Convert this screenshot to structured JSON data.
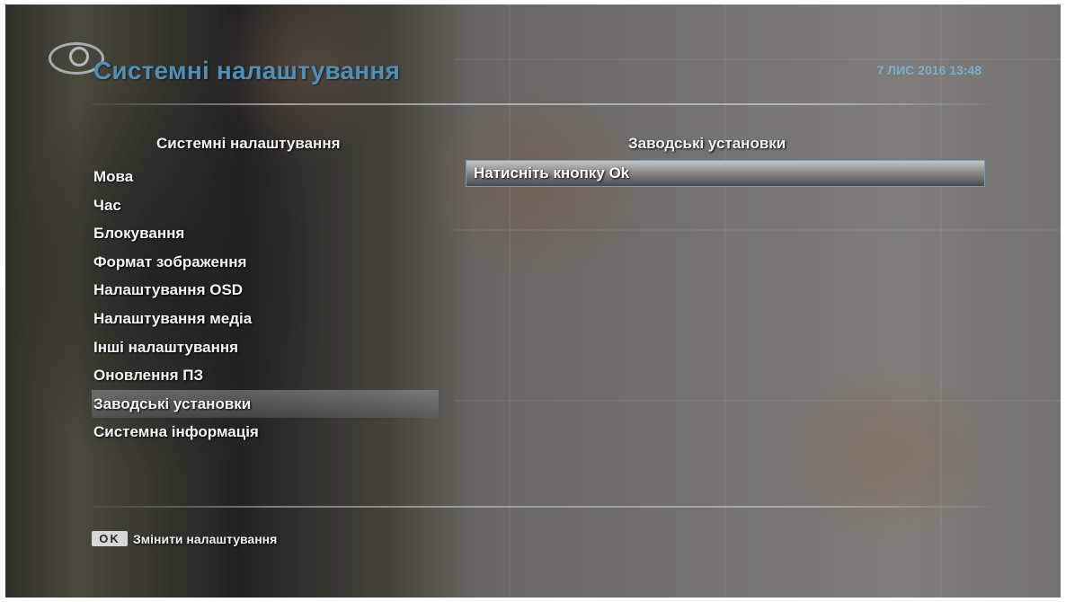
{
  "header": {
    "title": "Системні налаштування",
    "datetime": "7 ЛИС 2016 13:48"
  },
  "left_panel": {
    "heading": "Системні налаштування",
    "items": [
      {
        "label": "Мова",
        "selected": false
      },
      {
        "label": "Час",
        "selected": false
      },
      {
        "label": "Блокування",
        "selected": false
      },
      {
        "label": "Формат зображення",
        "selected": false
      },
      {
        "label": "Налаштування OSD",
        "selected": false
      },
      {
        "label": "Налаштування медіа",
        "selected": false
      },
      {
        "label": "Інші налаштування",
        "selected": false
      },
      {
        "label": "Оновлення ПЗ",
        "selected": false
      },
      {
        "label": "Заводські установки",
        "selected": true
      },
      {
        "label": "Системна інформація",
        "selected": false
      }
    ]
  },
  "right_panel": {
    "heading": "Заводські установки",
    "option": "Натисніть кнопку Ok"
  },
  "footer": {
    "key": "OK",
    "hint": "Змінити налаштування"
  },
  "colors": {
    "title": "#4f8fb8",
    "datetime": "#7aaed0",
    "option_border": "#6f9cc4"
  }
}
